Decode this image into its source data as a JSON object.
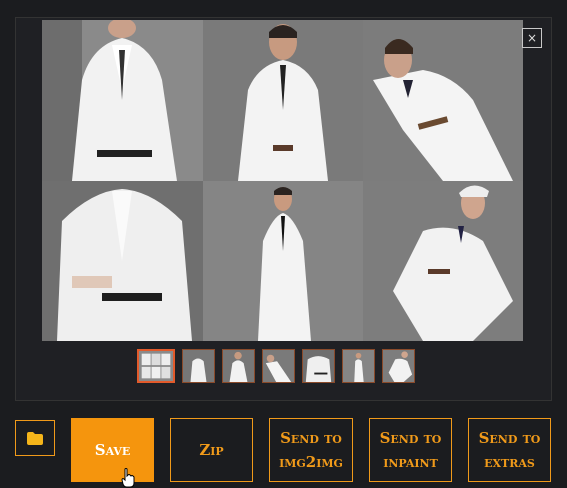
{
  "gallery": {
    "close_label": "×",
    "thumbnail_count": 7,
    "selected_thumbnail": 1
  },
  "actions": {
    "folder_icon": "folder-icon",
    "save_label": "Save",
    "zip_label": "Zip",
    "send_img2img_label": "Send to img2img",
    "send_inpaint_label": "Send to inpaint",
    "send_extras_label": "Send to extras"
  },
  "colors": {
    "accent": "#f5950d",
    "thumb_border_selected": "#e25a2b",
    "background": "#1b1c1f"
  }
}
